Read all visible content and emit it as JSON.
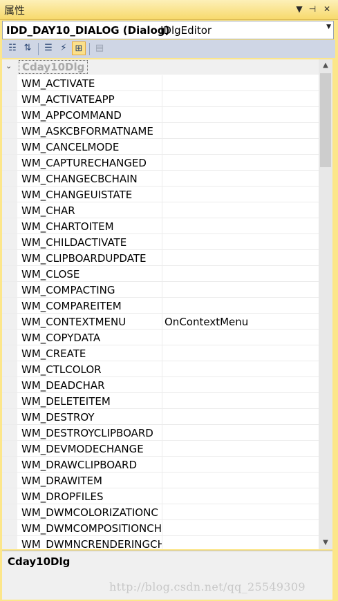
{
  "window": {
    "title": "属性",
    "buttons": {
      "dropdown": "▼",
      "pin": "⊣",
      "close": "✕"
    }
  },
  "object_selector": {
    "name": "IDD_DAY10_DIALOG (Dialog)",
    "type": "IDlgEditor"
  },
  "toolbar": {
    "icons": [
      "categorized-icon",
      "alphabetical-icon",
      "properties-icon",
      "events-icon",
      "messages-icon",
      "property-pages-icon"
    ],
    "active": "messages-icon"
  },
  "category": {
    "label": "Cday10Dlg",
    "expanded": true
  },
  "messages": [
    {
      "name": "WM_ACTIVATE",
      "handler": ""
    },
    {
      "name": "WM_ACTIVATEAPP",
      "handler": ""
    },
    {
      "name": "WM_APPCOMMAND",
      "handler": ""
    },
    {
      "name": "WM_ASKCBFORMATNAME",
      "handler": ""
    },
    {
      "name": "WM_CANCELMODE",
      "handler": ""
    },
    {
      "name": "WM_CAPTURECHANGED",
      "handler": ""
    },
    {
      "name": "WM_CHANGECBCHAIN",
      "handler": ""
    },
    {
      "name": "WM_CHANGEUISTATE",
      "handler": ""
    },
    {
      "name": "WM_CHAR",
      "handler": ""
    },
    {
      "name": "WM_CHARTOITEM",
      "handler": ""
    },
    {
      "name": "WM_CHILDACTIVATE",
      "handler": ""
    },
    {
      "name": "WM_CLIPBOARDUPDATE",
      "handler": ""
    },
    {
      "name": "WM_CLOSE",
      "handler": ""
    },
    {
      "name": "WM_COMPACTING",
      "handler": ""
    },
    {
      "name": "WM_COMPAREITEM",
      "handler": ""
    },
    {
      "name": "WM_CONTEXTMENU",
      "handler": "OnContextMenu"
    },
    {
      "name": "WM_COPYDATA",
      "handler": ""
    },
    {
      "name": "WM_CREATE",
      "handler": ""
    },
    {
      "name": "WM_CTLCOLOR",
      "handler": ""
    },
    {
      "name": "WM_DEADCHAR",
      "handler": ""
    },
    {
      "name": "WM_DELETEITEM",
      "handler": ""
    },
    {
      "name": "WM_DESTROY",
      "handler": ""
    },
    {
      "name": "WM_DESTROYCLIPBOARD",
      "handler": ""
    },
    {
      "name": "WM_DEVMODECHANGE",
      "handler": ""
    },
    {
      "name": "WM_DRAWCLIPBOARD",
      "handler": ""
    },
    {
      "name": "WM_DRAWITEM",
      "handler": ""
    },
    {
      "name": "WM_DROPFILES",
      "handler": ""
    },
    {
      "name": "WM_DWMCOLORIZATIONC",
      "handler": ""
    },
    {
      "name": "WM_DWMCOMPOSITIONCH",
      "handler": ""
    },
    {
      "name": "WM_DWMNCRENDERINGCH",
      "handler": ""
    }
  ],
  "description": {
    "title": "Cday10Dlg"
  },
  "watermark": "http://blog.csdn.net/qq_25549309",
  "colors": {
    "frame": "#fce68a",
    "toolbar": "#cfd6e5",
    "active_tool": "#fbe08a"
  }
}
